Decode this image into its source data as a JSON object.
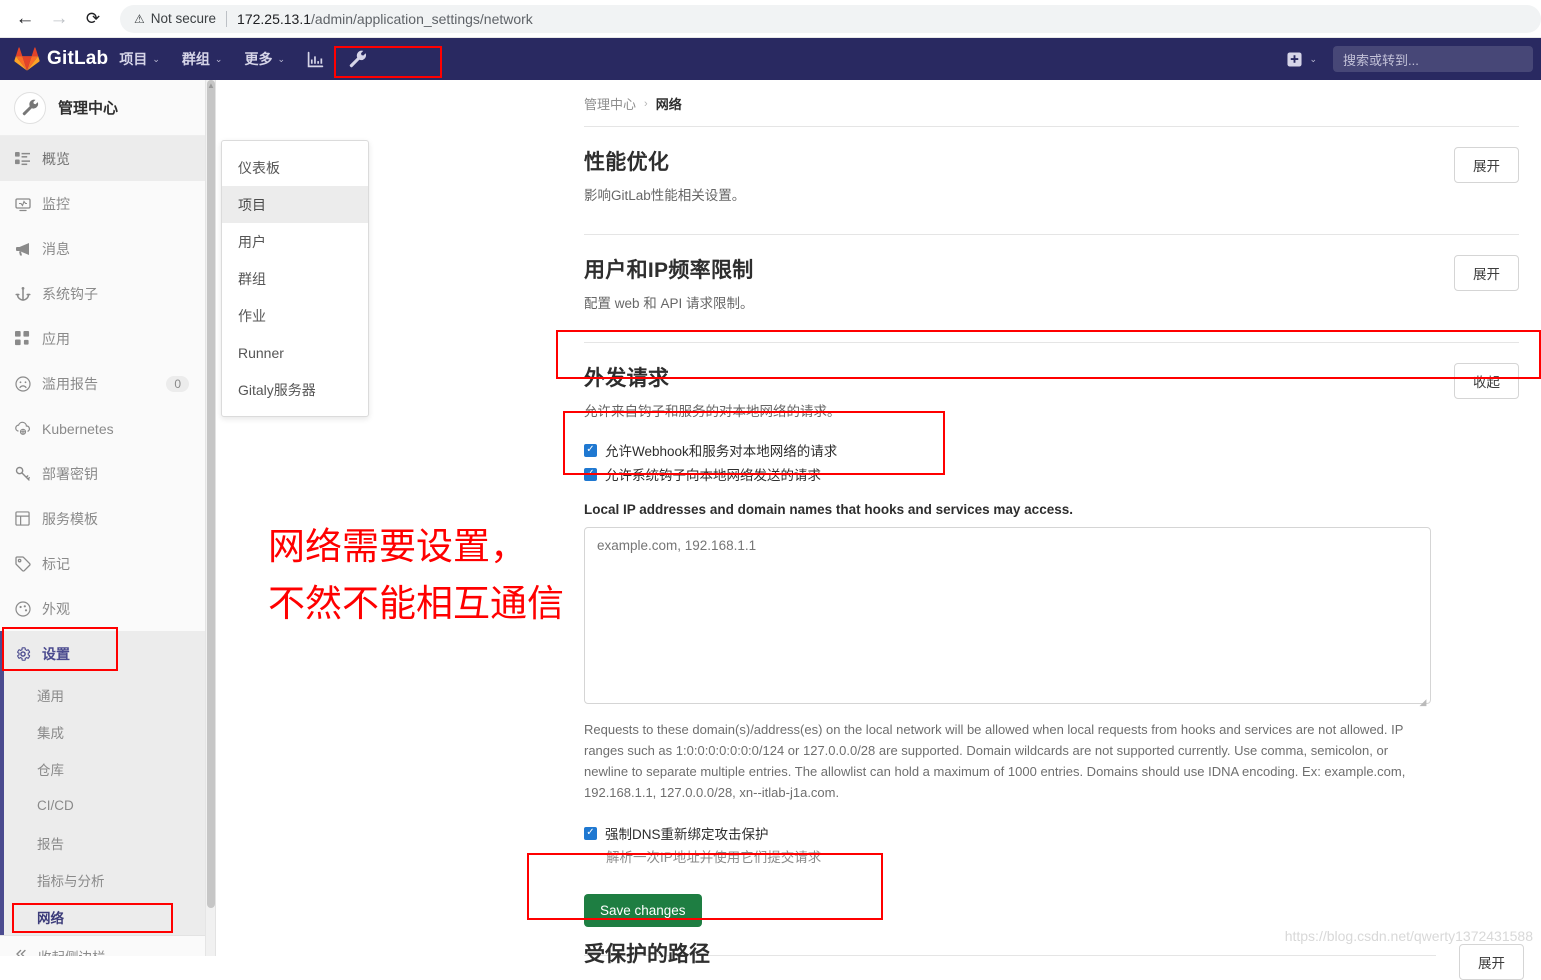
{
  "browser": {
    "back_icon": "back-arrow",
    "forward_icon": "forward-arrow",
    "reload_icon": "reload",
    "security_icon": "warning-triangle",
    "security_label": "Not secure",
    "url_host": "172.25.13.1",
    "url_path": "/admin/application_settings/network"
  },
  "navbar": {
    "brand": "GitLab",
    "items": [
      {
        "label": "项目",
        "caret": "⌄"
      },
      {
        "label": "群组",
        "caret": "⌄"
      },
      {
        "label": "更多",
        "caret": "⌄"
      }
    ],
    "analytics_icon": "chart-bar-icon",
    "admin_icon": "wrench-icon",
    "plus_icon": "plus-square-icon",
    "plus_caret": "⌄",
    "search_placeholder": "搜索或转到..."
  },
  "sidebar": {
    "context_title": "管理中心",
    "context_icon": "wrench-icon",
    "items": [
      {
        "label": "概览",
        "icon": "overview-icon",
        "active": true,
        "badge": ""
      },
      {
        "label": "监控",
        "icon": "monitor-icon",
        "active": false,
        "badge": ""
      },
      {
        "label": "消息",
        "icon": "megaphone-icon",
        "active": false,
        "badge": ""
      },
      {
        "label": "系统钩子",
        "icon": "hook-icon",
        "active": false,
        "badge": ""
      },
      {
        "label": "应用",
        "icon": "apps-icon",
        "active": false,
        "badge": ""
      },
      {
        "label": "滥用报告",
        "icon": "frown-icon",
        "active": false,
        "badge": "0"
      },
      {
        "label": "Kubernetes",
        "icon": "kubernetes-icon",
        "active": false,
        "badge": ""
      },
      {
        "label": "部署密钥",
        "icon": "key-icon",
        "active": false,
        "badge": ""
      },
      {
        "label": "服务模板",
        "icon": "template-icon",
        "active": false,
        "badge": ""
      },
      {
        "label": "标记",
        "icon": "tag-icon",
        "active": false,
        "badge": ""
      },
      {
        "label": "外观",
        "icon": "palette-icon",
        "active": false,
        "badge": ""
      }
    ],
    "settings": {
      "label": "设置",
      "icon": "gear-icon"
    },
    "sub_items": [
      {
        "label": "通用",
        "current": false
      },
      {
        "label": "集成",
        "current": false
      },
      {
        "label": "仓库",
        "current": false
      },
      {
        "label": "CI/CD",
        "current": false
      },
      {
        "label": "报告",
        "current": false
      },
      {
        "label": "指标与分析",
        "current": false
      },
      {
        "label": "网络",
        "current": true
      }
    ],
    "collapse": {
      "label": "收起侧边栏",
      "icon": "chevron-double-left-icon"
    }
  },
  "dropdown": {
    "items": [
      {
        "label": "仪表板",
        "active": false
      },
      {
        "label": "项目",
        "active": true
      },
      {
        "label": "用户",
        "active": false
      },
      {
        "label": "群组",
        "active": false
      },
      {
        "label": "作业",
        "active": false
      },
      {
        "label": "Runner",
        "active": false
      },
      {
        "label": "Gitaly服务器",
        "active": false
      }
    ]
  },
  "breadcrumb": {
    "root": "管理中心",
    "separator": "›",
    "current": "网络"
  },
  "sections": [
    {
      "title": "性能优化",
      "desc": "影响GitLab性能相关设置。",
      "button": "展开"
    },
    {
      "title": "用户和IP频率限制",
      "desc": "配置 web 和 API 请求限制。",
      "button": "展开"
    },
    {
      "title": "外发请求",
      "desc": "允许来自钩子和服务的对本地网络的请求。",
      "button": "收起"
    }
  ],
  "outbound": {
    "checkboxes": [
      {
        "label": "允许Webhook和服务对本地网络的请求",
        "checked": true
      },
      {
        "label": "允许系统钩子向本地网络发送的请求",
        "checked": true
      }
    ],
    "allowlist_label": "Local IP addresses and domain names that hooks and services may access.",
    "allowlist_placeholder": "example.com, 192.168.1.1",
    "allowlist_value": "",
    "help_text": "Requests to these domain(s)/address(es) on the local network will be allowed when local requests from hooks and services are not allowed. IP ranges such as 1:0:0:0:0:0:0:0/124 or 127.0.0.0/28 are supported. Domain wildcards are not supported currently. Use comma, semicolon, or newline to separate multiple entries. The allowlist can hold a maximum of 1000 entries. Domains should use IDNA encoding. Ex: example.com, 192.168.1.1, 127.0.0.0/28, xn--itlab-j1a.com.",
    "dns_checkbox": {
      "label": "强制DNS重新绑定攻击保护",
      "checked": true
    },
    "dns_help": "解析一次IP地址并使用它们提交请求",
    "save_label": "Save changes"
  },
  "bottom_section": {
    "title": "受保护的路径",
    "button": "展开"
  },
  "annotation": {
    "text": "网络需要设置，\n不然不能相互通信",
    "color": "#ff0000"
  },
  "watermark": "https://blog.csdn.net/qwerty1372431588",
  "colors": {
    "navbar_bg": "#292961",
    "accent_purple": "#4b4b8f",
    "checkbox_blue": "#1f78d1",
    "save_green": "#1e7e42",
    "annotation_red": "#ff0000"
  }
}
